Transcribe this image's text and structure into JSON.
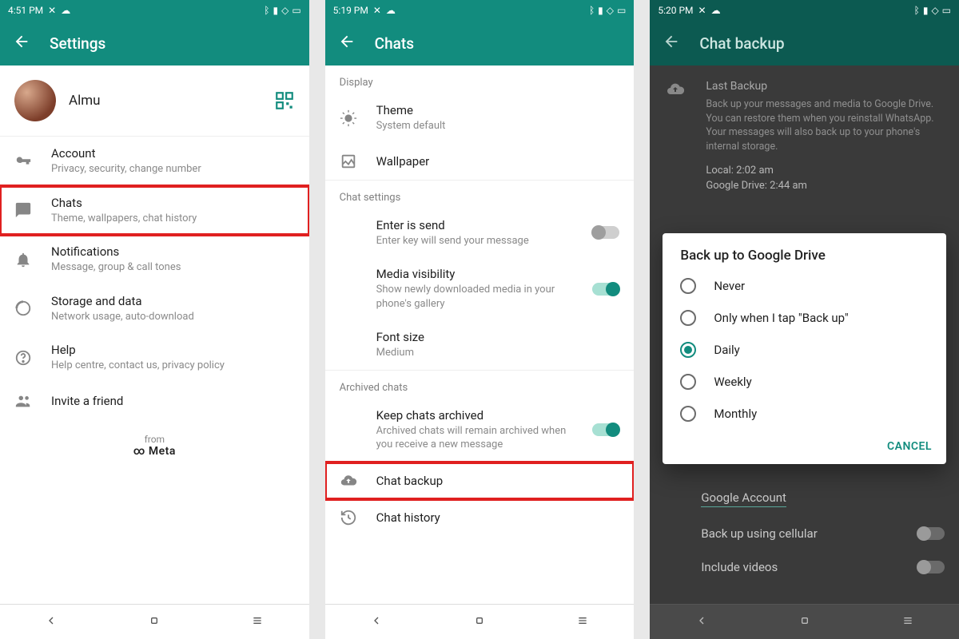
{
  "phone1": {
    "time": "4:51 PM",
    "title": "Settings",
    "user": "Almu",
    "items": {
      "account": {
        "label": "Account",
        "sub": "Privacy, security, change number"
      },
      "chats": {
        "label": "Chats",
        "sub": "Theme, wallpapers, chat history"
      },
      "notifications": {
        "label": "Notifications",
        "sub": "Message, group & call tones"
      },
      "storage": {
        "label": "Storage and data",
        "sub": "Network usage, auto-download"
      },
      "help": {
        "label": "Help",
        "sub": "Help centre, contact us, privacy policy"
      },
      "invite": {
        "label": "Invite a friend"
      }
    },
    "from": "from",
    "meta": "Meta"
  },
  "phone2": {
    "time": "5:19 PM",
    "title": "Chats",
    "sections": {
      "display": "Display",
      "chat": "Chat settings",
      "archived": "Archived chats"
    },
    "items": {
      "theme": {
        "label": "Theme",
        "sub": "System default"
      },
      "wallpaper": {
        "label": "Wallpaper"
      },
      "enter": {
        "label": "Enter is send",
        "sub": "Enter key will send your message"
      },
      "media": {
        "label": "Media visibility",
        "sub": "Show newly downloaded media in your phone's gallery"
      },
      "font": {
        "label": "Font size",
        "sub": "Medium"
      },
      "keep": {
        "label": "Keep chats archived",
        "sub": "Archived chats will remain archived when you receive a new message"
      },
      "backup": {
        "label": "Chat backup"
      },
      "history": {
        "label": "Chat history"
      }
    }
  },
  "phone3": {
    "time": "5:20 PM",
    "title": "Chat backup",
    "last_backup": "Last Backup",
    "desc": "Back up your messages and media to Google Drive. You can restore them when you reinstall WhatsApp. Your messages will also back up to your phone's internal storage.",
    "local": "Local: 2:02 am",
    "gdrive": "Google Drive: 2:44 am",
    "google_account": "Google Account",
    "cellular": "Back up using cellular",
    "videos": "Include videos",
    "dialog": {
      "title": "Back up to Google Drive",
      "options": [
        "Never",
        "Only when I tap \"Back up\"",
        "Daily",
        "Weekly",
        "Monthly"
      ],
      "selected": 2,
      "cancel": "CANCEL"
    }
  }
}
